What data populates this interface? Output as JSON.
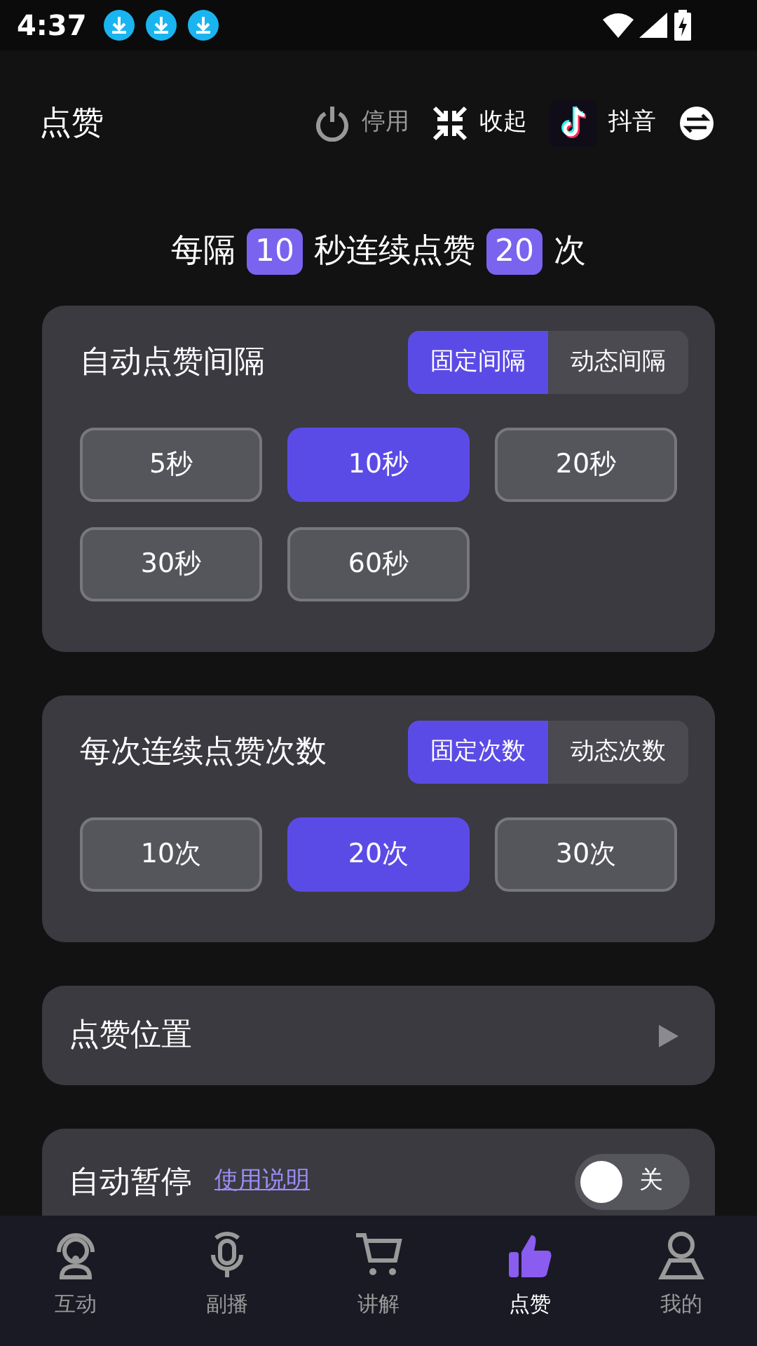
{
  "status_bar": {
    "time": "4:37",
    "notifications": [
      {
        "kind": "download"
      },
      {
        "kind": "download"
      },
      {
        "kind": "download"
      }
    ]
  },
  "header": {
    "title": "点赞",
    "actions": [
      {
        "kind": "power",
        "label": "停用",
        "disabled": true
      },
      {
        "kind": "collapse",
        "label": "收起",
        "disabled": false
      },
      {
        "kind": "app",
        "label": "抖音",
        "disabled": false
      }
    ]
  },
  "summary": [
    {
      "kind": "text",
      "text": "每隔"
    },
    {
      "kind": "value",
      "text": "10"
    },
    {
      "kind": "text",
      "text": "秒连续点赞"
    },
    {
      "kind": "value",
      "text": "20"
    },
    {
      "kind": "text",
      "text": "次"
    }
  ],
  "sections": [
    {
      "kind": "options",
      "title": "自动点赞间隔",
      "modes": [
        {
          "label": "固定间隔",
          "selected": true
        },
        {
          "label": "动态间隔",
          "selected": false
        }
      ],
      "options": [
        {
          "label": "5秒",
          "selected": false
        },
        {
          "label": "10秒",
          "selected": true
        },
        {
          "label": "20秒",
          "selected": false
        },
        {
          "label": "30秒",
          "selected": false
        },
        {
          "label": "60秒",
          "selected": false
        }
      ]
    },
    {
      "kind": "options",
      "title": "每次连续点赞次数",
      "modes": [
        {
          "label": "固定次数",
          "selected": true
        },
        {
          "label": "动态次数",
          "selected": false
        }
      ],
      "options": [
        {
          "label": "10次",
          "selected": false
        },
        {
          "label": "20次",
          "selected": true
        },
        {
          "label": "30次",
          "selected": false
        }
      ]
    },
    {
      "kind": "link",
      "title": "点赞位置"
    },
    {
      "kind": "toggle",
      "title": "自动暂停",
      "help": "使用说明",
      "toggle": {
        "on": false,
        "label": "关"
      }
    }
  ],
  "bottom_nav": [
    {
      "kind": "headset",
      "label": "互动",
      "selected": false
    },
    {
      "kind": "mic",
      "label": "副播",
      "selected": false
    },
    {
      "kind": "cart",
      "label": "讲解",
      "selected": false
    },
    {
      "kind": "thumb",
      "label": "点赞",
      "selected": true
    },
    {
      "kind": "person",
      "label": "我的",
      "selected": false
    }
  ]
}
